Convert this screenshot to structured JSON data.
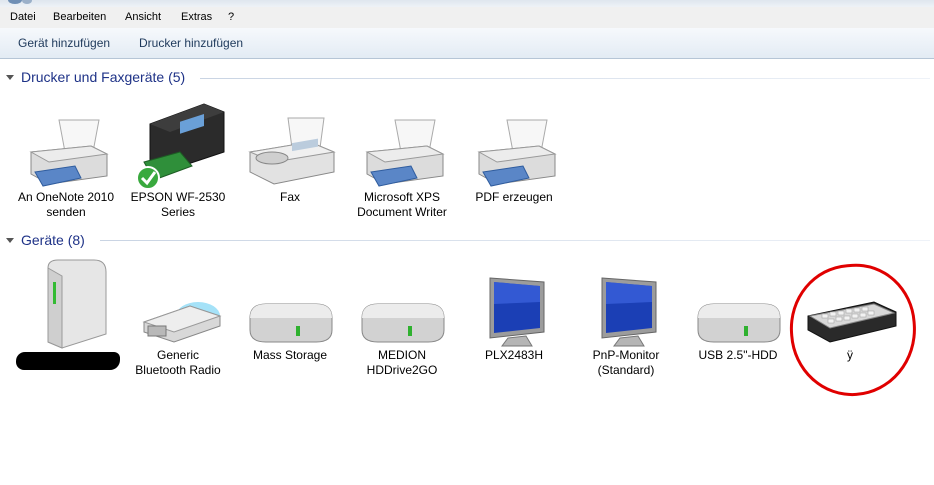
{
  "menu": [
    "Datei",
    "Bearbeiten",
    "Ansicht",
    "Extras",
    "?"
  ],
  "toolbar": {
    "add_device": "Gerät hinzufügen",
    "add_printer": "Drucker hinzufügen"
  },
  "groups": {
    "printers": {
      "title": "Drucker und Faxgeräte (5)"
    },
    "devices": {
      "title": "Geräte (8)"
    }
  },
  "printers": [
    {
      "label": "An OneNote 2010\nsenden",
      "icon": "printer-icon"
    },
    {
      "label": "EPSON WF-2530\nSeries",
      "icon": "printer-icon",
      "default": true
    },
    {
      "label": "Fax",
      "icon": "fax-icon"
    },
    {
      "label": "Microsoft XPS\nDocument Writer",
      "icon": "printer-icon"
    },
    {
      "label": "PDF erzeugen",
      "icon": "printer-icon"
    }
  ],
  "devices": [
    {
      "label": "",
      "icon": "computer-icon"
    },
    {
      "label": "Generic\nBluetooth Radio",
      "icon": "bluetooth-dongle-icon"
    },
    {
      "label": "Mass Storage",
      "icon": "drive-icon"
    },
    {
      "label": "MEDION\nHDDrive2GO",
      "icon": "drive-icon"
    },
    {
      "label": "PLX2483H",
      "icon": "monitor-icon"
    },
    {
      "label": "PnP-Monitor\n(Standard)",
      "icon": "monitor-icon"
    },
    {
      "label": "USB 2.5\"-HDD",
      "icon": "drive-icon"
    },
    {
      "label": "ÿ",
      "icon": "keyboard-icon"
    }
  ],
  "colors": {
    "header_text": "#1e3287",
    "annotation": "#e00000"
  }
}
